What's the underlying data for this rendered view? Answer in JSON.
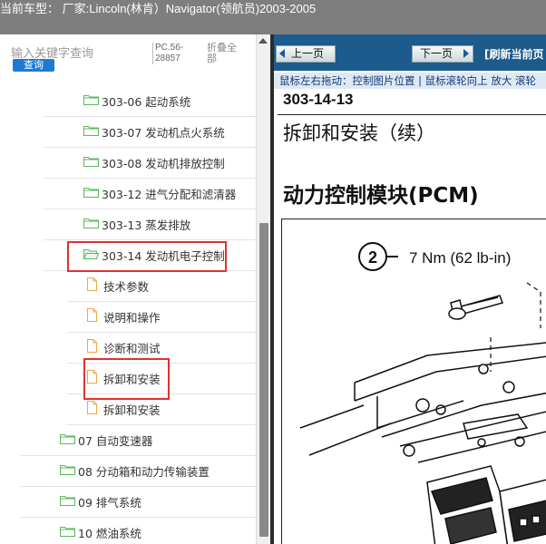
{
  "window": {
    "title": "当前车型：  厂家:Lincoln(林肯）Navigator(领航员)2003-2005"
  },
  "left_panel": {
    "search_placeholder": "输入关键字查询",
    "query_button": "查询",
    "pc_code": "PC.56-28857",
    "collapse_all": "折叠全部",
    "tree": [
      {
        "label": "303-06 起动系统",
        "type": "folder"
      },
      {
        "label": "303-07 发动机点火系统",
        "type": "folder"
      },
      {
        "label": "303-08 发动机排放控制",
        "type": "folder"
      },
      {
        "label": "303-12 进气分配和滤清器",
        "type": "folder"
      },
      {
        "label": "303-13 蒸发排放",
        "type": "folder"
      },
      {
        "label": "303-14 发动机电子控制",
        "type": "folder-open"
      },
      {
        "label": "技术参数",
        "type": "doc"
      },
      {
        "label": "说明和操作",
        "type": "doc"
      },
      {
        "label": "诊断和测试",
        "type": "doc"
      },
      {
        "label": "拆卸和安装",
        "type": "doc"
      },
      {
        "label": "拆卸和安装",
        "type": "doc"
      },
      {
        "label": "07 自动变速器",
        "type": "folder"
      },
      {
        "label": "08 分动箱和动力传输装置",
        "type": "folder"
      },
      {
        "label": "09 排气系统",
        "type": "folder"
      },
      {
        "label": "10 燃油系统",
        "type": "folder"
      }
    ]
  },
  "right_panel": {
    "prev_button": "上一页",
    "next_button": "下一页",
    "refresh_label": "[刷新当前页",
    "hint_text": "鼠标左右拖动：控制图片位置 | 鼠标滚轮向上 放大   滚轮",
    "doc_number": "303-14-13",
    "doc_subtitle": "拆卸和安装（续）",
    "doc_heading": "动力控制模块(PCM)",
    "figure": {
      "callout_number": "2",
      "torque_label": "7 Nm (62 lb-in)"
    }
  },
  "colors": {
    "titlebar": "#7e7e7e",
    "navbar": "#1c5b8c",
    "highlight": "#e0312e",
    "query_button": "#1f7bd1",
    "folder": "#5cb85c",
    "doc_icon": "#f0a640"
  }
}
